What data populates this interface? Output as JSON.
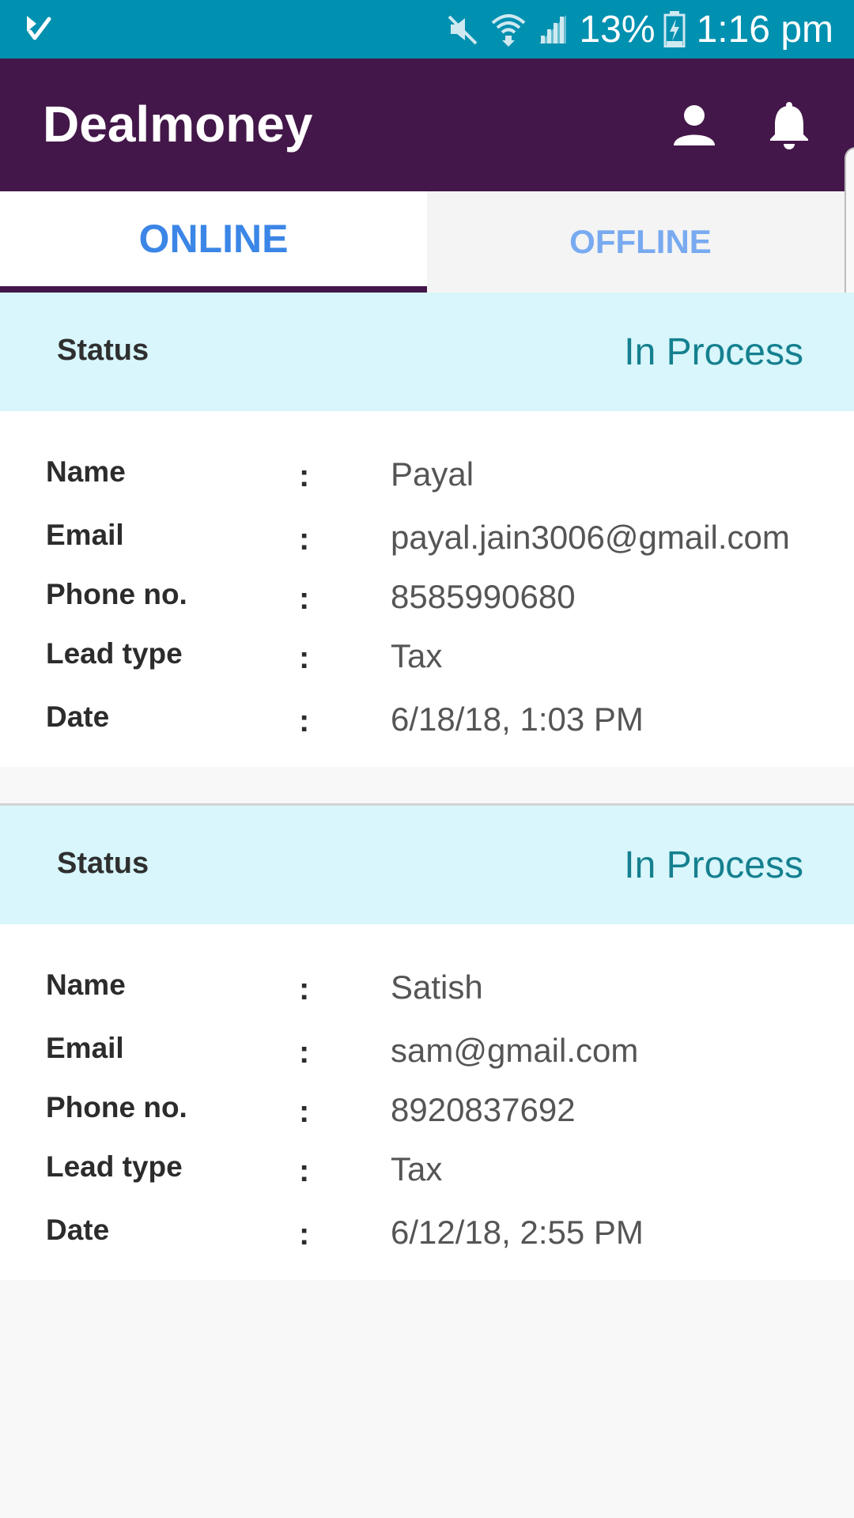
{
  "status_bar": {
    "battery": "13%",
    "time": "1:16 pm"
  },
  "app_bar": {
    "title": "Dealmoney"
  },
  "tabs": [
    {
      "label": "ONLINE",
      "active": true
    },
    {
      "label": "OFFLINE",
      "active": false
    }
  ],
  "field_labels": {
    "name": "Name",
    "email": "Email",
    "phone": "Phone no.",
    "lead_type": "Lead type",
    "date": "Date",
    "separator": ":"
  },
  "leads": [
    {
      "status_label": "Status",
      "status": "In Process",
      "name": "Payal",
      "email": "payal.jain3006@gmail.com",
      "phone": "8585990680",
      "lead_type": "Tax",
      "date": "6/18/18, 1:03 PM"
    },
    {
      "status_label": "Status",
      "status": "In Process",
      "name": "Satish",
      "email": "sam@gmail.com",
      "phone": "8920837692",
      "lead_type": "Tax",
      "date": "6/12/18, 2:55 PM"
    }
  ],
  "colors": {
    "status_bar": "#0090b0",
    "app_bar": "#431749",
    "tab_active_text": "#3b86e6",
    "tab_inactive_text": "#78aaf0",
    "status_band": "#d8f6fb",
    "status_value": "#15808f"
  }
}
